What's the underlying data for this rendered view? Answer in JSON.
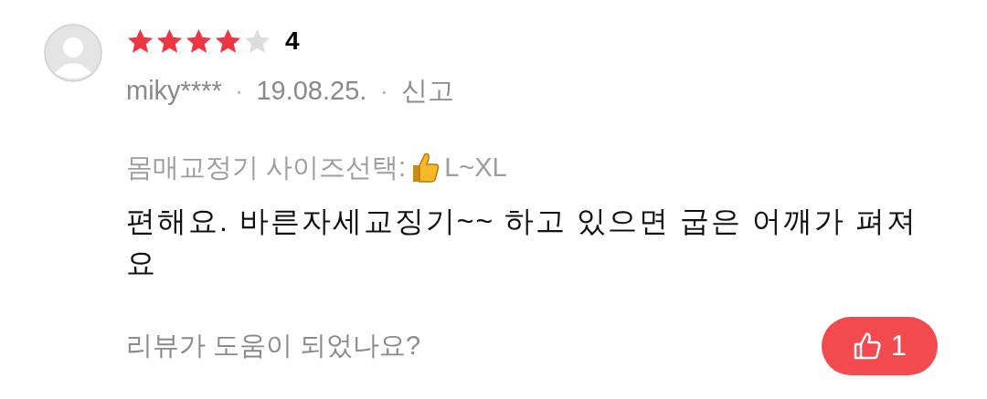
{
  "review": {
    "stars": 4,
    "rating": "4",
    "author": "miky****",
    "separator_1": "·",
    "date": "19.08.25.",
    "separator_2": "·",
    "report_link": "신고",
    "option_label": "몸매교정기 사이즈선택:",
    "option_value": "L~XL",
    "text": "편해요. 바른자세교징기~~ 하고 있으면 굽은 어깨가 펴져요",
    "helpful_question": "리뷰가 도움이 되었나요?",
    "helpful_count": "1",
    "helpful_selected": true
  }
}
